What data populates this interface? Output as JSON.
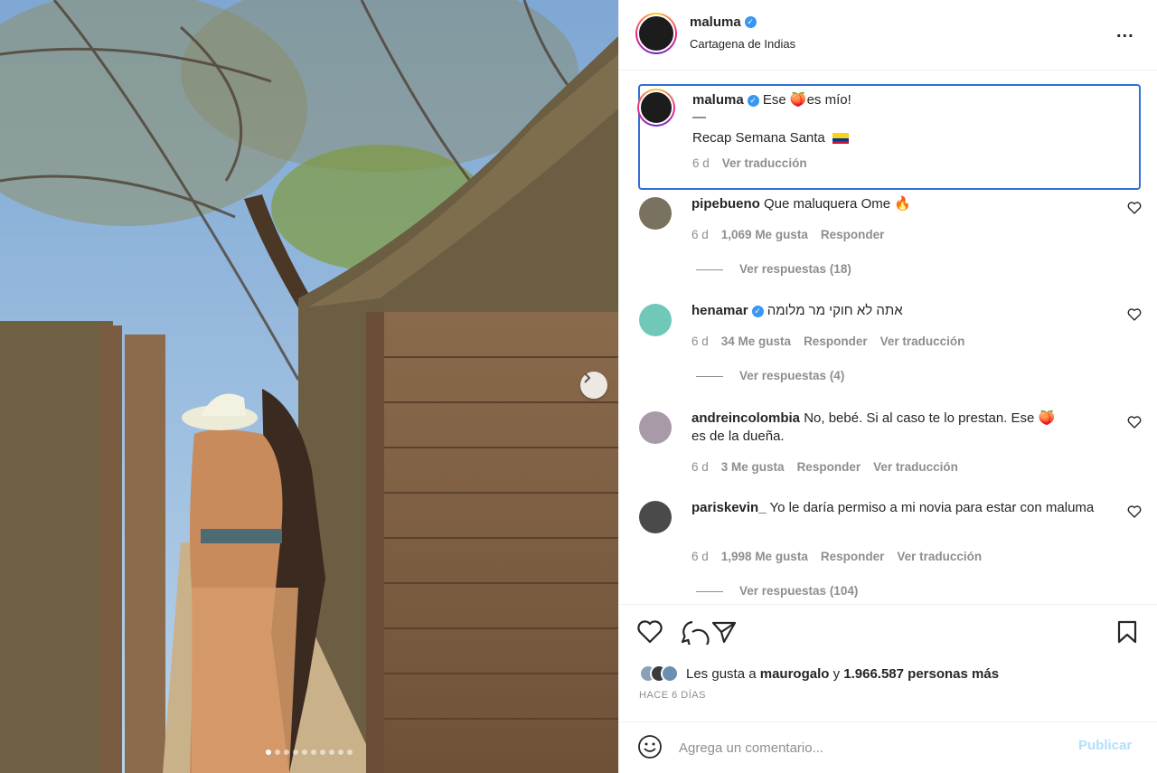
{
  "post": {
    "username": "maluma",
    "location": "Cartagena de Indias",
    "more_label": "...",
    "caption": {
      "username": "maluma",
      "line1_pre": "Ese ",
      "line1_post": "es mío!",
      "divider": "—",
      "line2": "Recap Semana Santa",
      "time": "6 d",
      "translate": "Ver traducción"
    },
    "image": {
      "slides_total": 10,
      "slide_current": 1
    }
  },
  "comments": [
    {
      "username": "pipebueno",
      "text": "Que maluquera Ome",
      "emoji": "🔥",
      "verified": false,
      "time": "6 d",
      "likes": "1,069 Me gusta",
      "reply": "Responder",
      "translate": "",
      "replies": "Ver respuestas (18)"
    },
    {
      "username": "henamar",
      "text": "אתה לא חוקי מר מלומה",
      "emoji": "",
      "verified": true,
      "time": "6 d",
      "likes": "34 Me gusta",
      "reply": "Responder",
      "translate": "Ver traducción",
      "replies": "Ver respuestas (4)"
    },
    {
      "username": "andreincolombia",
      "text": "No, bebé. Si al caso te lo prestan. Ese",
      "text2": "es de la dueña.",
      "emoji": "🍑",
      "verified": false,
      "time": "6 d",
      "likes": "3 Me gusta",
      "reply": "Responder",
      "translate": "Ver traducción",
      "replies": ""
    },
    {
      "username": "pariskevin_",
      "text": "Yo le daría permiso a mi novia para estar con maluma",
      "emoji": "",
      "verified": false,
      "time": "6 d",
      "likes": "1,998 Me gusta",
      "reply": "Responder",
      "translate": "Ver traducción",
      "replies": "Ver respuestas (104)"
    }
  ],
  "likes": {
    "prefix": "Les gusta a",
    "user": "maurogalo",
    "middle": "y",
    "count": "1.966.587 personas más"
  },
  "posted_ago": "HACE 6 DÍAS",
  "composer": {
    "placeholder": "Agrega un comentario...",
    "publish": "Publicar"
  },
  "icons": [
    "heart-icon",
    "comment-icon",
    "share-icon",
    "bookmark-icon",
    "emoji-icon",
    "chevron-right-icon",
    "verified-icon",
    "more-icon"
  ],
  "colors": {
    "verified": "#3897f0",
    "highlight_border": "#2f6fd6",
    "publish_disabled": "#b2dffc",
    "muted": "#8e8e8e"
  }
}
